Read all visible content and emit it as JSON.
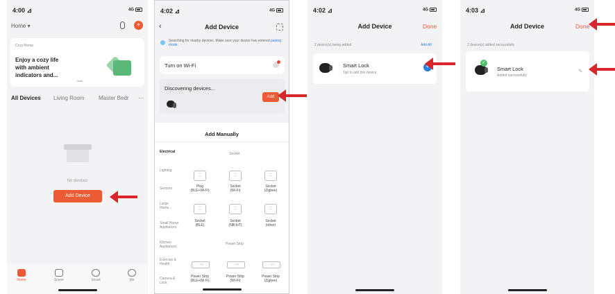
{
  "colors": {
    "accent": "#ec5a36",
    "blue": "#2a7de1",
    "arrow": "#d8262c",
    "green": "#4cbf6b"
  },
  "screen1": {
    "time": "4:00 ⊿",
    "signal": "4G",
    "home_label": "Home ▾",
    "banner": {
      "tag": "Cozy Home",
      "text_l1": "Enjoy a cozy life",
      "text_l2": "with ambient",
      "text_l3": "indicators and..."
    },
    "tabs": [
      "All Devices",
      "Living Room",
      "Master Bedr"
    ],
    "more": "···",
    "empty_text": "No devices",
    "add_button": "Add Device",
    "nav": [
      "Home",
      "Scene",
      "Smart",
      "Me"
    ]
  },
  "screen2": {
    "time": "4:02 ⊿",
    "signal": "4G",
    "title": "Add Device",
    "search_text": "Searching for nearby devices. Make sure your device has entered",
    "search_link": "pairing mode.",
    "wifi_label": "Turn on Wi-Fi",
    "discover_label": "Discovering devices...",
    "add_label": "Add",
    "manual_title": "Add Manually",
    "categories": [
      "Electrical",
      "Lighting",
      "Sensors",
      "Large Home...",
      "Small Home Appliances",
      "Kitchen Appliances",
      "Exercise & Health",
      "Camera & Lock"
    ],
    "socket_header": "Socket",
    "power_strip_header": "Power Strip",
    "items": [
      {
        "l1": "Plug",
        "l2": "(BLE+Wi-Fi)"
      },
      {
        "l1": "Socket",
        "l2": "(Wi-Fi)"
      },
      {
        "l1": "Socket",
        "l2": "(Zigbee)"
      },
      {
        "l1": "Socket",
        "l2": "(BLE)"
      },
      {
        "l1": "Socket",
        "l2": "(NB-IoT)"
      },
      {
        "l1": "Socket",
        "l2": "(other)"
      },
      {
        "l1": "Power Strip",
        "l2": "(BLE+Wi-Fi)"
      },
      {
        "l1": "Power Strip",
        "l2": "(Wi-Fi)"
      },
      {
        "l1": "Power Strip",
        "l2": "(Zigbee)"
      }
    ]
  },
  "screen3": {
    "time": "4:02 ⊿",
    "signal": "4G",
    "title": "Add Device",
    "done": "Done",
    "status_line": "2 device(s) being added",
    "add_all": "Add All",
    "device_name": "Smart Lock",
    "device_sub": "Tap to add this device"
  },
  "screen4": {
    "time": "4:03 ⊿",
    "signal": "4G",
    "title": "Add Device",
    "done": "Done",
    "status_line": "2 device(s) added successfully",
    "device_name": "Smart Lock",
    "device_sub": "Added successfully"
  }
}
